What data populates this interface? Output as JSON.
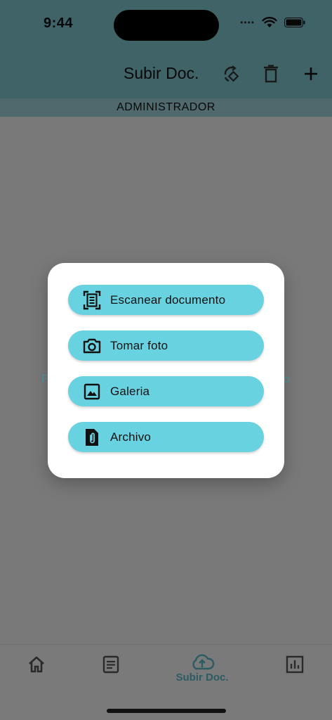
{
  "status_bar": {
    "time": "9:44"
  },
  "header": {
    "title": "Subir Doc.",
    "actions": [
      "rotate-diamond-icon",
      "trash-icon",
      "plus-icon"
    ]
  },
  "role_bar": {
    "label": "ADMINISTRADOR"
  },
  "background_peek": {
    "left_char": "P",
    "right_char": "o"
  },
  "dialog": {
    "options": [
      {
        "label": "Escanear documento",
        "icon": "document-scanner-icon"
      },
      {
        "label": "Tomar foto",
        "icon": "camera-icon"
      },
      {
        "label": "Galeria",
        "icon": "image-icon"
      },
      {
        "label": "Archivo",
        "icon": "file-attachment-icon"
      }
    ]
  },
  "bottom_nav": {
    "items": [
      {
        "icon": "home-icon",
        "label": ""
      },
      {
        "icon": "document-icon",
        "label": ""
      },
      {
        "icon": "cloud-upload-icon",
        "label": "Subir Doc.",
        "active": true
      },
      {
        "icon": "bar-chart-icon",
        "label": ""
      }
    ]
  },
  "colors": {
    "header": "#7fc6cf",
    "accent": "#68d2e0",
    "active_nav": "#58b7c4"
  }
}
